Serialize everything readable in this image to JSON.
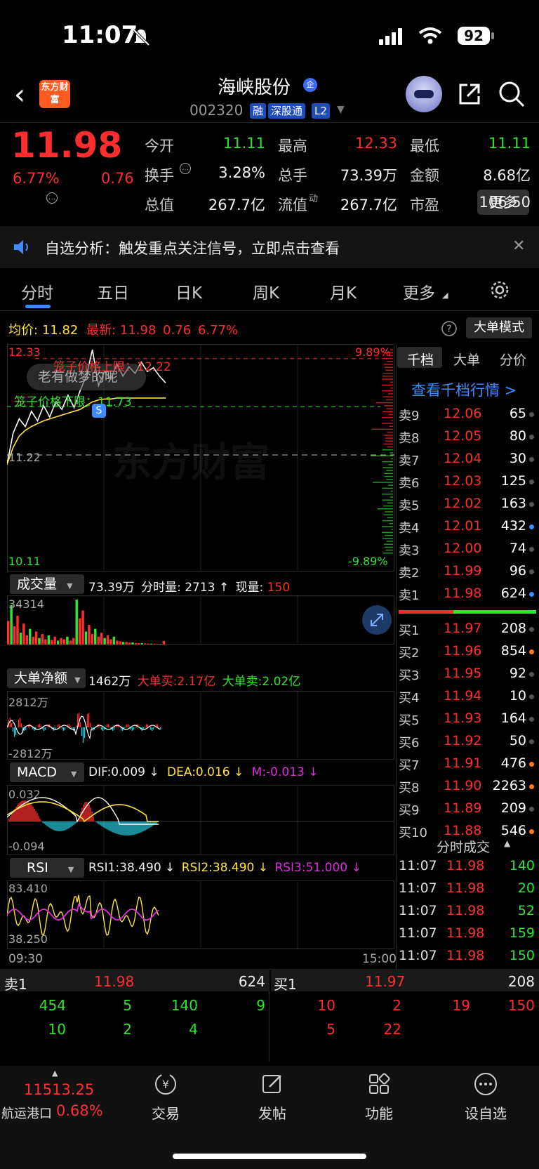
{
  "status_bar": {
    "time": "11:07",
    "battery": "92"
  },
  "header": {
    "logo_text": "东方财富",
    "stock_name": "海峡股份",
    "ent_badge": "企",
    "stock_code": "002320",
    "tags": [
      "融",
      "深股通",
      "L2"
    ]
  },
  "quote": {
    "price": "11.98",
    "change_pct": "6.77%",
    "change": "0.76",
    "fields": [
      {
        "label": "今开",
        "value": "11.11",
        "color": "#2ee62e"
      },
      {
        "label": "最高",
        "value": "12.33",
        "color": "#ff2d2d"
      },
      {
        "label": "最低",
        "value": "11.11",
        "color": "#2ee62e"
      },
      {
        "label": "换手",
        "value": "3.28%",
        "color": "#f0f0f0"
      },
      {
        "label": "总手",
        "value": "73.39万",
        "color": "#f0f0f0"
      },
      {
        "label": "金额",
        "value": "8.68亿",
        "color": "#f0f0f0"
      },
      {
        "label": "总值",
        "value": "267.7亿",
        "color": "#f0f0f0"
      },
      {
        "label": "流值",
        "value": "267.7亿",
        "color": "#f0f0f0"
      },
      {
        "label": "市盈",
        "value": "106.50",
        "color": "#f0f0f0"
      }
    ],
    "pe_sup": "动",
    "more_label": "更多"
  },
  "notice": {
    "text": "自选分析：触发重点关注信号，立即点击查看"
  },
  "tabs": [
    "分时",
    "五日",
    "日K",
    "周K",
    "月K",
    "更多"
  ],
  "chart_legend": {
    "avg_label": "均价:",
    "avg_value": "11.82",
    "latest_label": "最新:",
    "latest_value": "11.98",
    "latest_chg": "0.76",
    "latest_pct": "6.77%",
    "bigorder_mode": "大单模式"
  },
  "price_chart": {
    "high_label": "12.33",
    "low_label": "10.11",
    "mid_label": "11.22",
    "upper_pct": "9.89%",
    "lower_pct": "-9.89%",
    "cage_upper": "笼子价格上限：12.22",
    "cage_lower": "笼子价格下限：11.73",
    "chat_bubble": "老有做梦的呢",
    "watermark": "东方财富",
    "s_marker": "S"
  },
  "chart_data": [
    {
      "type": "line",
      "title": "分时",
      "ylim": [
        10.11,
        12.33
      ],
      "series": [
        {
          "name": "最新",
          "values": [
            11.12,
            11.45,
            11.6,
            11.52,
            11.68,
            11.58,
            11.74,
            11.62,
            11.78,
            11.7,
            11.85,
            11.72,
            11.9,
            12.05,
            12.33,
            11.95,
            12.1,
            12.02,
            12.18,
            12.05,
            12.15,
            12.08,
            12.2,
            12.1,
            12.14,
            12.05,
            11.98
          ]
        },
        {
          "name": "均价",
          "values": [
            11.12,
            11.3,
            11.42,
            11.48,
            11.52,
            11.55,
            11.58,
            11.6,
            11.62,
            11.64,
            11.66,
            11.68,
            11.7,
            11.74,
            11.78,
            11.8,
            11.81,
            11.81,
            11.82,
            11.82,
            11.82,
            11.82,
            11.82,
            11.82,
            11.82,
            11.82,
            11.82
          ]
        }
      ]
    },
    {
      "type": "bar",
      "title": "成交量",
      "ylim": [
        0,
        34314
      ],
      "values": [
        18000,
        30000,
        14000,
        22000,
        9000,
        16000,
        7000,
        12000,
        6000,
        10000,
        5000,
        8000,
        4000,
        7000,
        3500,
        6000,
        3000,
        5000,
        4000,
        6000,
        3000,
        5000,
        34314,
        20000,
        26000,
        10000,
        15000,
        8000,
        12000,
        6000,
        9000,
        5000,
        7000,
        4000,
        6000,
        3000,
        2500,
        2000,
        2000,
        1500,
        1500,
        1200,
        1000,
        1000,
        800,
        800,
        700,
        600,
        500,
        400,
        2713
      ]
    }
  ],
  "volume_panel": {
    "select": "成交量",
    "total": "73.39万",
    "minute_label": "分时量:",
    "minute_value": "2713",
    "now_label": "现量:",
    "now_value": "150",
    "max_label": "34314"
  },
  "net_panel": {
    "select": "大单净额",
    "value": "1462万",
    "buy": "大单买:2.17亿",
    "sell": "大单卖:2.02亿",
    "top": "2812万",
    "bottom": "-2812万"
  },
  "macd_panel": {
    "select": "MACD",
    "dif": "DIF:0.009",
    "dea": "DEA:0.016",
    "m": "M:-0.013",
    "top": "0.032",
    "bottom": "-0.094"
  },
  "rsi_panel": {
    "select": "RSI",
    "rsi1": "RSI1:38.490",
    "rsi2": "RSI2:38.490",
    "rsi3": "RSI3:51.000",
    "top": "83.410",
    "bottom": "38.250",
    "start_time": "09:30",
    "end_time": "15:00"
  },
  "order_book": {
    "tabs": [
      "千档",
      "大单",
      "分价"
    ],
    "link": "查看千档行情 >",
    "asks": [
      {
        "label": "卖9",
        "price": "12.06",
        "vol": "65",
        "dot": "#555"
      },
      {
        "label": "卖8",
        "price": "12.05",
        "vol": "80",
        "dot": "#555"
      },
      {
        "label": "卖7",
        "price": "12.04",
        "vol": "30",
        "dot": "#555"
      },
      {
        "label": "卖6",
        "price": "12.03",
        "vol": "125",
        "dot": "#555"
      },
      {
        "label": "卖5",
        "price": "12.02",
        "vol": "163",
        "dot": "#555"
      },
      {
        "label": "卖4",
        "price": "12.01",
        "vol": "432",
        "dot": "#3d8bff"
      },
      {
        "label": "卖3",
        "price": "12.00",
        "vol": "74",
        "dot": "#555"
      },
      {
        "label": "卖2",
        "price": "11.99",
        "vol": "96",
        "dot": "#555"
      },
      {
        "label": "卖1",
        "price": "11.98",
        "vol": "624",
        "dot": "#3d8bff"
      }
    ],
    "bids": [
      {
        "label": "买1",
        "price": "11.97",
        "vol": "208",
        "dot": "#555"
      },
      {
        "label": "买2",
        "price": "11.96",
        "vol": "854",
        "dot": "#ff7a1a"
      },
      {
        "label": "买3",
        "price": "11.95",
        "vol": "92",
        "dot": "#555"
      },
      {
        "label": "买4",
        "price": "11.94",
        "vol": "10",
        "dot": "#555"
      },
      {
        "label": "买5",
        "price": "11.93",
        "vol": "164",
        "dot": "#555"
      },
      {
        "label": "买6",
        "price": "11.92",
        "vol": "50",
        "dot": "#555"
      },
      {
        "label": "买7",
        "price": "11.91",
        "vol": "476",
        "dot": "#ff7a1a"
      },
      {
        "label": "买8",
        "price": "11.90",
        "vol": "2263",
        "dot": "#ff7a1a"
      },
      {
        "label": "买9",
        "price": "11.89",
        "vol": "209",
        "dot": "#555"
      },
      {
        "label": "买10",
        "price": "11.88",
        "vol": "546",
        "dot": "#ff7a1a"
      }
    ]
  },
  "trades": {
    "title": "分时成交",
    "rows": [
      {
        "time": "11:07",
        "price": "11.98",
        "vol": "140"
      },
      {
        "time": "11:07",
        "price": "11.98",
        "vol": "20"
      },
      {
        "time": "11:07",
        "price": "11.98",
        "vol": "52"
      },
      {
        "time": "11:07",
        "price": "11.98",
        "vol": "159"
      },
      {
        "time": "11:07",
        "price": "11.98",
        "vol": "150"
      }
    ]
  },
  "summary": {
    "sell_label": "卖1",
    "sell_price": "11.98",
    "sell_vol": "624",
    "buy_label": "买1",
    "buy_price": "11.97",
    "buy_vol": "208",
    "sell_row1": [
      "454",
      "5",
      "140",
      "9"
    ],
    "sell_row2": [
      "10",
      "2",
      "4"
    ],
    "buy_row1": [
      "10",
      "2",
      "19",
      "150"
    ],
    "buy_row2": [
      "5",
      "22"
    ]
  },
  "bottom_nav": {
    "index_value": "11513.25",
    "index_name": "航运港口",
    "index_pct": "0.68%",
    "items": [
      "交易",
      "发帖",
      "功能",
      "设自选"
    ]
  }
}
